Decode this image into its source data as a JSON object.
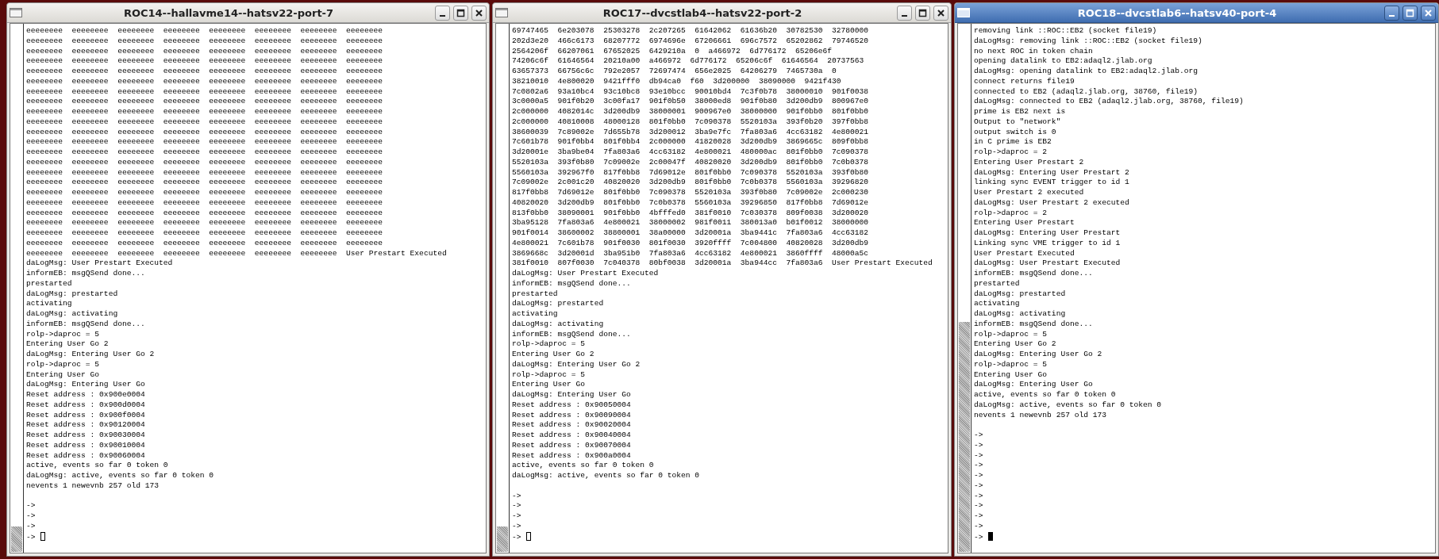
{
  "windows": [
    {
      "title": "ROC14--hallavme14--hatsv22-port-7",
      "focused": false,
      "output": [
        "eeeeeeee  eeeeeeee  eeeeeeee  eeeeeeee  eeeeeeee  eeeeeeee  eeeeeeee  eeeeeeee",
        "eeeeeeee  eeeeeeee  eeeeeeee  eeeeeeee  eeeeeeee  eeeeeeee  eeeeeeee  eeeeeeee",
        "eeeeeeee  eeeeeeee  eeeeeeee  eeeeeeee  eeeeeeee  eeeeeeee  eeeeeeee  eeeeeeee",
        "eeeeeeee  eeeeeeee  eeeeeeee  eeeeeeee  eeeeeeee  eeeeeeee  eeeeeeee  eeeeeeee",
        "eeeeeeee  eeeeeeee  eeeeeeee  eeeeeeee  eeeeeeee  eeeeeeee  eeeeeeee  eeeeeeee",
        "eeeeeeee  eeeeeeee  eeeeeeee  eeeeeeee  eeeeeeee  eeeeeeee  eeeeeeee  eeeeeeee",
        "eeeeeeee  eeeeeeee  eeeeeeee  eeeeeeee  eeeeeeee  eeeeeeee  eeeeeeee  eeeeeeee",
        "eeeeeeee  eeeeeeee  eeeeeeee  eeeeeeee  eeeeeeee  eeeeeeee  eeeeeeee  eeeeeeee",
        "eeeeeeee  eeeeeeee  eeeeeeee  eeeeeeee  eeeeeeee  eeeeeeee  eeeeeeee  eeeeeeee",
        "eeeeeeee  eeeeeeee  eeeeeeee  eeeeeeee  eeeeeeee  eeeeeeee  eeeeeeee  eeeeeeee",
        "eeeeeeee  eeeeeeee  eeeeeeee  eeeeeeee  eeeeeeee  eeeeeeee  eeeeeeee  eeeeeeee",
        "eeeeeeee  eeeeeeee  eeeeeeee  eeeeeeee  eeeeeeee  eeeeeeee  eeeeeeee  eeeeeeee",
        "eeeeeeee  eeeeeeee  eeeeeeee  eeeeeeee  eeeeeeee  eeeeeeee  eeeeeeee  eeeeeeee",
        "eeeeeeee  eeeeeeee  eeeeeeee  eeeeeeee  eeeeeeee  eeeeeeee  eeeeeeee  eeeeeeee",
        "eeeeeeee  eeeeeeee  eeeeeeee  eeeeeeee  eeeeeeee  eeeeeeee  eeeeeeee  eeeeeeee",
        "eeeeeeee  eeeeeeee  eeeeeeee  eeeeeeee  eeeeeeee  eeeeeeee  eeeeeeee  eeeeeeee",
        "eeeeeeee  eeeeeeee  eeeeeeee  eeeeeeee  eeeeeeee  eeeeeeee  eeeeeeee  eeeeeeee",
        "eeeeeeee  eeeeeeee  eeeeeeee  eeeeeeee  eeeeeeee  eeeeeeee  eeeeeeee  eeeeeeee",
        "eeeeeeee  eeeeeeee  eeeeeeee  eeeeeeee  eeeeeeee  eeeeeeee  eeeeeeee  eeeeeeee",
        "eeeeeeee  eeeeeeee  eeeeeeee  eeeeeeee  eeeeeeee  eeeeeeee  eeeeeeee  eeeeeeee",
        "eeeeeeee  eeeeeeee  eeeeeeee  eeeeeeee  eeeeeeee  eeeeeeee  eeeeeeee  eeeeeeee",
        "eeeeeeee  eeeeeeee  eeeeeeee  eeeeeeee  eeeeeeee  eeeeeeee  eeeeeeee  eeeeeeee",
        "eeeeeeee  eeeeeeee  eeeeeeee  eeeeeeee  eeeeeeee  eeeeeeee  eeeeeeee  User Prestart Executed",
        "daLogMsg: User Prestart Executed",
        "informEB: msgQSend done...",
        "prestarted",
        "daLogMsg: prestarted",
        "activating",
        "daLogMsg: activating",
        "informEB: msgQSend done...",
        "rolp->daproc = 5",
        "Entering User Go 2",
        "daLogMsg: Entering User Go 2",
        "rolp->daproc = 5",
        "Entering User Go",
        "daLogMsg: Entering User Go",
        "Reset address : 0x900e0004",
        "Reset address : 0x900d0004",
        "Reset address : 0x900f0004",
        "Reset address : 0x90120004",
        "Reset address : 0x90030004",
        "Reset address : 0x90010004",
        "Reset address : 0x90060004",
        "active, events so far 0 token 0",
        "daLogMsg: active, events so far 0 token 0",
        "nevents 1 newevnb 257 old 173"
      ],
      "prompts": [
        "->",
        "->",
        "->",
        "->"
      ]
    },
    {
      "title": "ROC17--dvcstlab4--hatsv22-port-2",
      "focused": false,
      "output": [
        "69747465  6e203078  25303278  2c207265  61642062  61636b20  30782530  32780000",
        "202d3e20  466c6173  68207772  6974696e  67206661  696c7572  65202862  79746520",
        "2564206f  66207061  67652025  6429210a  0  a466972  6d776172  65206e6f",
        "74206c6f  61646564  20210a00  a466972  6d776172  65206c6f  61646564  20737563",
        "63657373  66756c6c  792e2057  72697474  656e2025  64206279  7465730a  0",
        "38210010  4e800020  9421fff0  db94ca0  f60  3d200000  38090000  9421f430",
        "7c0802a6  93a10bc4  93c10bc8  93e10bcc  90010bd4  7c3f0b78  38000010  901f0038",
        "3c0000a5  901f0b20  3c00fa17  901f0b50  38000ed8  901f0b80  3d200db9  800967e0",
        "2c000000  4082014c  3d200db9  38000001  900967e0  38000000  901f0bb0  801f0bb0",
        "2c000000  40810008  48000128  801f0bb0  7c090378  5520103a  393f0b20  397f0bb8",
        "38600039  7c89002e  7d655b78  3d200012  3ba9e7fc  7fa803a6  4cc63182  4e800021",
        "7c601b78  901f0bb4  801f0bb4  2c000000  41820028  3d200db9  3869665c  809f0bb8",
        "3d20001e  3ba9be04  7fa803a6  4cc63182  4e800021  480000ac  801f0bb0  7c090378",
        "5520103a  393f0b80  7c09002e  2c00047f  40820020  3d200db9  801f0bb0  7c0b0378",
        "5560103a  392967f0  817f0bb8  7d69012e  801f0bb0  7c090378  5520103a  393f0b80",
        "7c09002e  2c001c20  40820020  3d200db9  801f0bb0  7c0b0378  5560103a  39296820",
        "817f0bb8  7d69012e  801f0bb0  7c090378  5520103a  393f0b80  7c09002e  2c000230",
        "40820020  3d200db9  801f0bb0  7c0b0378  5560103a  39296850  817f0bb8  7d69012e",
        "813f0bb0  38090001  901f0bb0  4bfffed0  381f0010  7c030378  809f0038  3d200020",
        "3ba95128  7fa803a6  4e800021  38000002  981f0011  380013a0  b01f0012  38000000",
        "901f0014  38600002  38800001  38a00000  3d20001a  3ba9441c  7fa803a6  4cc63182",
        "4e800021  7c601b78  901f0030  801f0030  3920ffff  7c004800  40820028  3d200db9",
        "3869668c  3d20001d  3ba951b0  7fa803a6  4cc63182  4e800021  3860ffff  48000a5c",
        "381f0010  807f0030  7c040378  80bf0038  3d20001a  3ba944cc  7fa803a6  User Prestart Executed",
        "daLogMsg: User Prestart Executed",
        "informEB: msgQSend done...",
        "prestarted",
        "daLogMsg: prestarted",
        "activating",
        "daLogMsg: activating",
        "informEB: msgQSend done...",
        "rolp->daproc = 5",
        "Entering User Go 2",
        "daLogMsg: Entering User Go 2",
        "rolp->daproc = 5",
        "Entering User Go",
        "daLogMsg: Entering User Go",
        "Reset address : 0x90050004",
        "Reset address : 0x90090004",
        "Reset address : 0x90020004",
        "Reset address : 0x90040004",
        "Reset address : 0x90070004",
        "Reset address : 0x900a0004",
        "active, events so far 0 token 0",
        "daLogMsg: active, events so far 0 token 0"
      ],
      "prompts": [
        "->",
        "->",
        "->",
        "->",
        "->"
      ]
    },
    {
      "title": "ROC18--dvcstlab6--hatsv40-port-4",
      "focused": true,
      "output": [
        "removing link ::ROC::EB2 (socket file19)",
        "daLogMsg: removing link ::ROC::EB2 (socket file19)",
        "no next ROC in token chain",
        "opening datalink to EB2:adaql2.jlab.org",
        "daLogMsg: opening datalink to EB2:adaql2.jlab.org",
        "connect returns file19",
        "connected to EB2 (adaql2.jlab.org, 38760, file19)",
        "daLogMsg: connected to EB2 (adaql2.jlab.org, 38760, file19)",
        "prime is EB2 next is",
        "Output to \"network\"",
        "output switch is 0",
        "in C prime is EB2",
        "rolp->daproc = 2",
        "Entering User Prestart 2",
        "daLogMsg: Entering User Prestart 2",
        "linking sync EVENT trigger to id 1",
        "User Prestart 2 executed",
        "daLogMsg: User Prestart 2 executed",
        "rolp->daproc = 2",
        "Entering User Prestart",
        "daLogMsg: Entering User Prestart",
        "Linking sync VME trigger to id 1",
        "User Prestart Executed",
        "daLogMsg: User Prestart Executed",
        "informEB: msgQSend done...",
        "prestarted",
        "daLogMsg: prestarted",
        "activating",
        "daLogMsg: activating",
        "informEB: msgQSend done...",
        "rolp->daproc = 5",
        "Entering User Go 2",
        "daLogMsg: Entering User Go 2",
        "rolp->daproc = 5",
        "Entering User Go",
        "daLogMsg: Entering User Go",
        "active, events so far 0 token 0",
        "daLogMsg: active, events so far 0 token 0",
        "nevents 1 newevnb 257 old 173"
      ],
      "prompts": [
        "->",
        "->",
        "->",
        "->",
        "->",
        "->",
        "->",
        "->",
        "->",
        "->",
        "->"
      ]
    }
  ]
}
